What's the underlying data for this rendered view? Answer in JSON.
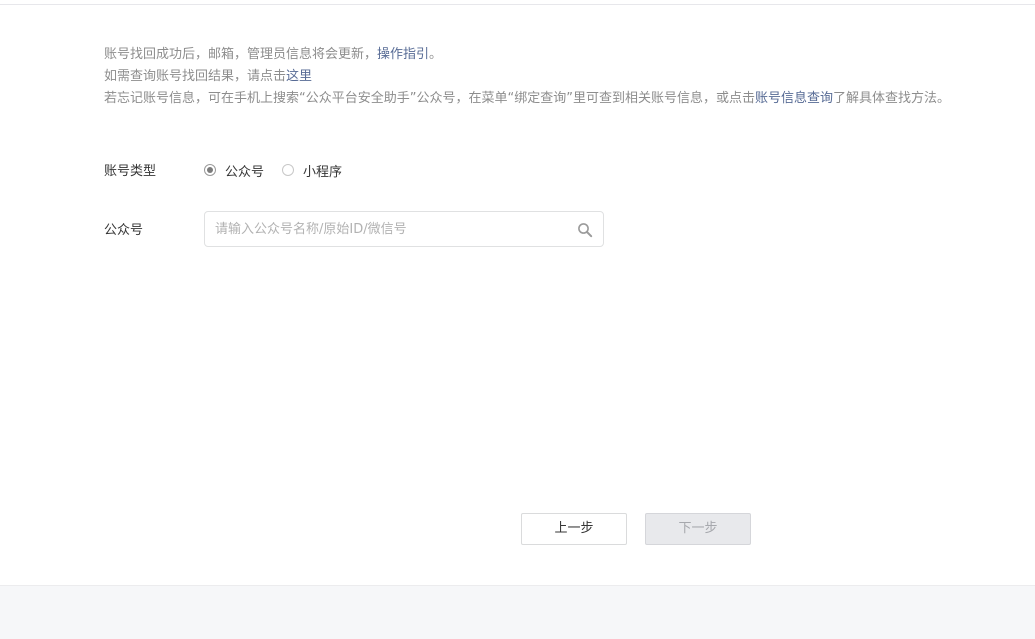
{
  "notice": {
    "line1_text": "账号找回成功后，邮箱，管理员信息将会更新，",
    "line1_link": "操作指引",
    "line1_suffix": "。",
    "line2_text": "如需查询账号找回结果，请点击",
    "line2_link": "这里",
    "line3_text": "若忘记账号信息，可在手机上搜索“公众平台安全助手”公众号，在菜单“绑定查询”里可查到相关账号信息，或点击",
    "line3_link": "账号信息查询",
    "line3_suffix": "了解具体查找方法。"
  },
  "form": {
    "type_label": "账号类型",
    "type_options": [
      {
        "label": "公众号",
        "selected": true
      },
      {
        "label": "小程序",
        "selected": false
      }
    ],
    "account_label": "公众号",
    "search_placeholder": "请输入公众号名称/原始ID/微信号",
    "search_value": "",
    "search_icon": "search-icon"
  },
  "buttons": {
    "prev_label": "上一步",
    "next_label": "下一步",
    "next_disabled": true
  },
  "colors": {
    "link": "#576b95",
    "muted_text": "#8d8d8d",
    "text": "#353535"
  }
}
